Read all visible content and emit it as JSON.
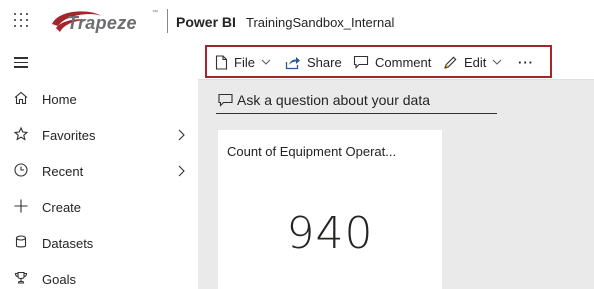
{
  "header": {
    "logo_text": "Trapeze",
    "logo_tm": "™",
    "app_name": "Power BI",
    "workspace": "TrainingSandbox_Internal"
  },
  "nav": {
    "items": [
      {
        "label": "Home",
        "icon": "home-icon"
      },
      {
        "label": "Favorites",
        "icon": "star-icon",
        "has_chevron": true
      },
      {
        "label": "Recent",
        "icon": "clock-icon",
        "has_chevron": true
      },
      {
        "label": "Create",
        "icon": "plus-icon"
      },
      {
        "label": "Datasets",
        "icon": "database-icon"
      },
      {
        "label": "Goals",
        "icon": "trophy-icon"
      }
    ]
  },
  "toolbar": {
    "file_label": "File",
    "share_label": "Share",
    "comment_label": "Comment",
    "edit_label": "Edit",
    "more_label": "···"
  },
  "qa": {
    "placeholder": "Ask a question about your data"
  },
  "card": {
    "title": "Count of Equipment Operat...",
    "value": "940"
  },
  "colors": {
    "highlight_border": "#a4262c",
    "canvas_bg": "#eaeaea",
    "logo_red": "#a4262c"
  }
}
